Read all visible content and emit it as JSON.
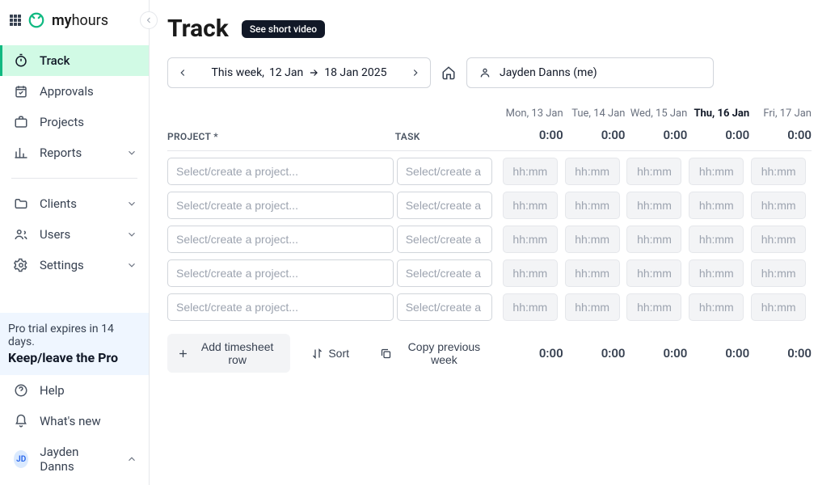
{
  "brand": {
    "name_bold": "my",
    "name_light": "hours"
  },
  "sidebar": {
    "items": [
      {
        "label": "Track",
        "active": true,
        "icon": "stopwatch-icon"
      },
      {
        "label": "Approvals",
        "icon": "calendar-check-icon"
      },
      {
        "label": "Projects",
        "icon": "briefcase-icon"
      },
      {
        "label": "Reports",
        "icon": "bar-chart-icon",
        "expandable": true
      },
      {
        "label": "Clients",
        "icon": "folder-icon",
        "expandable": true
      },
      {
        "label": "Users",
        "icon": "users-icon",
        "expandable": true
      },
      {
        "label": "Settings",
        "icon": "gear-icon",
        "expandable": true
      }
    ],
    "trial": {
      "line1": "Pro trial expires in 14 days.",
      "line2": "Keep/leave the Pro"
    },
    "bottom": {
      "help": "Help",
      "whats_new": "What's new",
      "user_name": "Jayden Danns",
      "user_initials": "JD"
    }
  },
  "page": {
    "title": "Track",
    "video_badge": "See short video",
    "week_prefix": "This week,",
    "week_from": "12 Jan",
    "week_to": "18 Jan 2025",
    "user_filter": "Jayden Danns (me)"
  },
  "columns": {
    "project": "PROJECT *",
    "task": "TASK",
    "days": [
      {
        "label": "Mon, 13 Jan",
        "today": false
      },
      {
        "label": "Tue, 14 Jan",
        "today": false
      },
      {
        "label": "Wed, 15 Jan",
        "today": false
      },
      {
        "label": "Thu, 16 Jan",
        "today": true
      },
      {
        "label": "Fri, 17 Jan",
        "today": false
      }
    ]
  },
  "totals": {
    "header": [
      "0:00",
      "0:00",
      "0:00",
      "0:00",
      "0:00"
    ],
    "footer": [
      "0:00",
      "0:00",
      "0:00",
      "0:00",
      "0:00"
    ]
  },
  "placeholders": {
    "project": "Select/create a project...",
    "task": "Select/create a t...",
    "time": "hh:mm"
  },
  "actions": {
    "add_row": "Add timesheet row",
    "sort": "Sort",
    "copy": "Copy previous week"
  },
  "row_count": 5
}
